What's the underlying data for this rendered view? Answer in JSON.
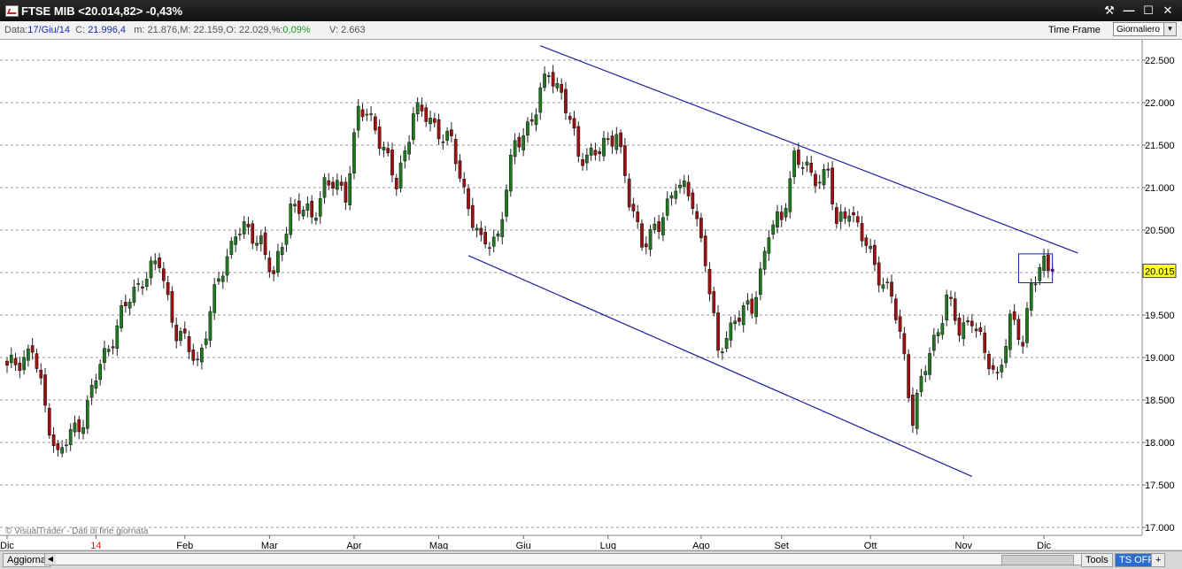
{
  "window": {
    "title": "FTSE MIB <20.014,82> -0,43%",
    "buttons": [
      "⚒",
      "—",
      "☐",
      "✕"
    ]
  },
  "infobar": {
    "data_label": "Data:",
    "data_value": "17/Giu/14",
    "c_label": "C:",
    "c_value": "21.996,4",
    "m_label": "m:",
    "m_value": "21.876,",
    "M_label": "M:",
    "M_value": "22.159,",
    "o_label": "O:",
    "o_value": "22.029,",
    "pct_label": "%:",
    "pct_value": "0,09%",
    "v_label": "V:",
    "v_value": "2.663",
    "timeframe_label": "Time Frame",
    "timeframe_value": "Giornaliero"
  },
  "watermark": "© VisualTrader - Dati di fine giornata",
  "bottombar": {
    "refresh": "Aggiorna",
    "tools": "Tools",
    "ts": "TS OFF",
    "plus": "+"
  },
  "colors": {
    "up": "#1f7a1f",
    "down": "#a01010",
    "trendline": "#1c1ca0",
    "last_price_bg": "#ffff33"
  },
  "chart_data": {
    "type": "candlestick",
    "ylim": [
      17.0,
      22.5
    ],
    "yticks": [
      "22.500",
      "22.000",
      "21.500",
      "21.000",
      "20.500",
      "20.000",
      "19.500",
      "19.000",
      "18.500",
      "18.000",
      "17.500",
      "17.000"
    ],
    "ytick_values": [
      22.5,
      22.0,
      21.5,
      21.0,
      20.5,
      20.0,
      19.5,
      19.0,
      18.5,
      18.0,
      17.5,
      17.0
    ],
    "grid": true,
    "last_price_label": "20.015",
    "last_price": 20.015,
    "months": [
      {
        "label": "Dic",
        "day": 0,
        "highlight": false
      },
      {
        "label": "14",
        "day": 21,
        "highlight": true
      },
      {
        "label": "Feb",
        "day": 42,
        "highlight": false
      },
      {
        "label": "Mar",
        "day": 62,
        "highlight": false
      },
      {
        "label": "Apr",
        "day": 82,
        "highlight": false
      },
      {
        "label": "Mag",
        "day": 102,
        "highlight": false
      },
      {
        "label": "Giu",
        "day": 122,
        "highlight": false
      },
      {
        "label": "Lug",
        "day": 142,
        "highlight": false
      },
      {
        "label": "Ago",
        "day": 164,
        "highlight": false
      },
      {
        "label": "Set",
        "day": 183,
        "highlight": false
      },
      {
        "label": "Ott",
        "day": 204,
        "highlight": false
      },
      {
        "label": "Nov",
        "day": 226,
        "highlight": false
      },
      {
        "label": "Dic",
        "day": 245,
        "highlight": false
      }
    ],
    "anchors": [
      [
        0,
        18.85
      ],
      [
        6,
        19.1
      ],
      [
        9,
        18.4
      ],
      [
        12,
        17.85
      ],
      [
        18,
        18.3
      ],
      [
        22,
        18.9
      ],
      [
        27,
        19.5
      ],
      [
        32,
        19.95
      ],
      [
        36,
        20.1
      ],
      [
        40,
        19.3
      ],
      [
        45,
        18.95
      ],
      [
        50,
        19.9
      ],
      [
        54,
        20.5
      ],
      [
        60,
        20.4
      ],
      [
        63,
        19.9
      ],
      [
        67,
        20.8
      ],
      [
        72,
        20.65
      ],
      [
        75,
        21.05
      ],
      [
        80,
        20.95
      ],
      [
        83,
        21.9
      ],
      [
        87,
        21.75
      ],
      [
        92,
        21.0
      ],
      [
        96,
        21.9
      ],
      [
        100,
        21.8
      ],
      [
        105,
        21.5
      ],
      [
        109,
        20.8
      ],
      [
        112,
        20.3
      ],
      [
        116,
        20.45
      ],
      [
        120,
        21.5
      ],
      [
        125,
        21.9
      ],
      [
        128,
        22.4
      ],
      [
        131,
        22.1
      ],
      [
        135,
        21.4
      ],
      [
        140,
        21.4
      ],
      [
        144,
        21.7
      ],
      [
        147,
        20.8
      ],
      [
        150,
        20.4
      ],
      [
        154,
        20.5
      ],
      [
        158,
        21.1
      ],
      [
        162,
        20.8
      ],
      [
        165,
        20.2
      ],
      [
        168,
        19.0
      ],
      [
        172,
        19.5
      ],
      [
        176,
        19.55
      ],
      [
        180,
        20.5
      ],
      [
        183,
        20.6
      ],
      [
        186,
        21.4
      ],
      [
        190,
        21.1
      ],
      [
        194,
        21.2
      ],
      [
        196,
        20.5
      ],
      [
        199,
        20.8
      ],
      [
        202,
        20.4
      ],
      [
        206,
        20.0
      ],
      [
        209,
        19.7
      ],
      [
        212,
        19.0
      ],
      [
        214,
        18.3
      ],
      [
        216,
        18.7
      ],
      [
        219,
        19.2
      ],
      [
        222,
        19.7
      ],
      [
        225,
        19.3
      ],
      [
        228,
        19.5
      ],
      [
        231,
        19.0
      ],
      [
        234,
        18.8
      ],
      [
        237,
        19.4
      ],
      [
        240,
        19.2
      ],
      [
        242,
        19.9
      ],
      [
        245,
        20.05
      ],
      [
        247,
        20.015
      ]
    ],
    "trendlines": [
      {
        "from": [
          126,
          22.67
        ],
        "to": [
          253,
          20.23
        ]
      },
      {
        "from": [
          109,
          20.2
        ],
        "to": [
          228,
          17.6
        ]
      }
    ],
    "highlight_box": {
      "day_from": 239,
      "day_to": 247,
      "y_from": 19.88,
      "y_to": 20.22
    }
  }
}
